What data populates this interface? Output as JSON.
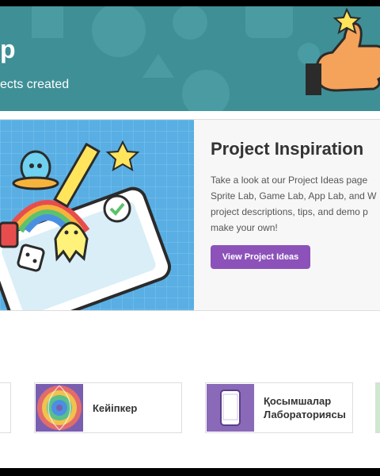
{
  "banner": {
    "title": "p",
    "subtitle": "ects created"
  },
  "inspiration": {
    "title": "Project Inspiration",
    "body_lines": [
      "Take a look at our Project Ideas page",
      "Sprite Lab, Game Lab, App Lab, and W",
      "project descriptions, tips, and demo p",
      "make your own!"
    ],
    "button_label": "View Project Ideas"
  },
  "tiles": [
    {
      "label": ""
    },
    {
      "label": "Кейіпкер",
      "icon": "colorful-swirl-thumbnail"
    },
    {
      "label_line1": "Қосымшалар",
      "label_line2": "Лабораториясы",
      "icon": "phone-icon"
    },
    {
      "label": ""
    }
  ],
  "colors": {
    "banner_bg": "#3f8f96",
    "button_bg": "#8c52ba",
    "card_bg": "#f7f7f7"
  }
}
